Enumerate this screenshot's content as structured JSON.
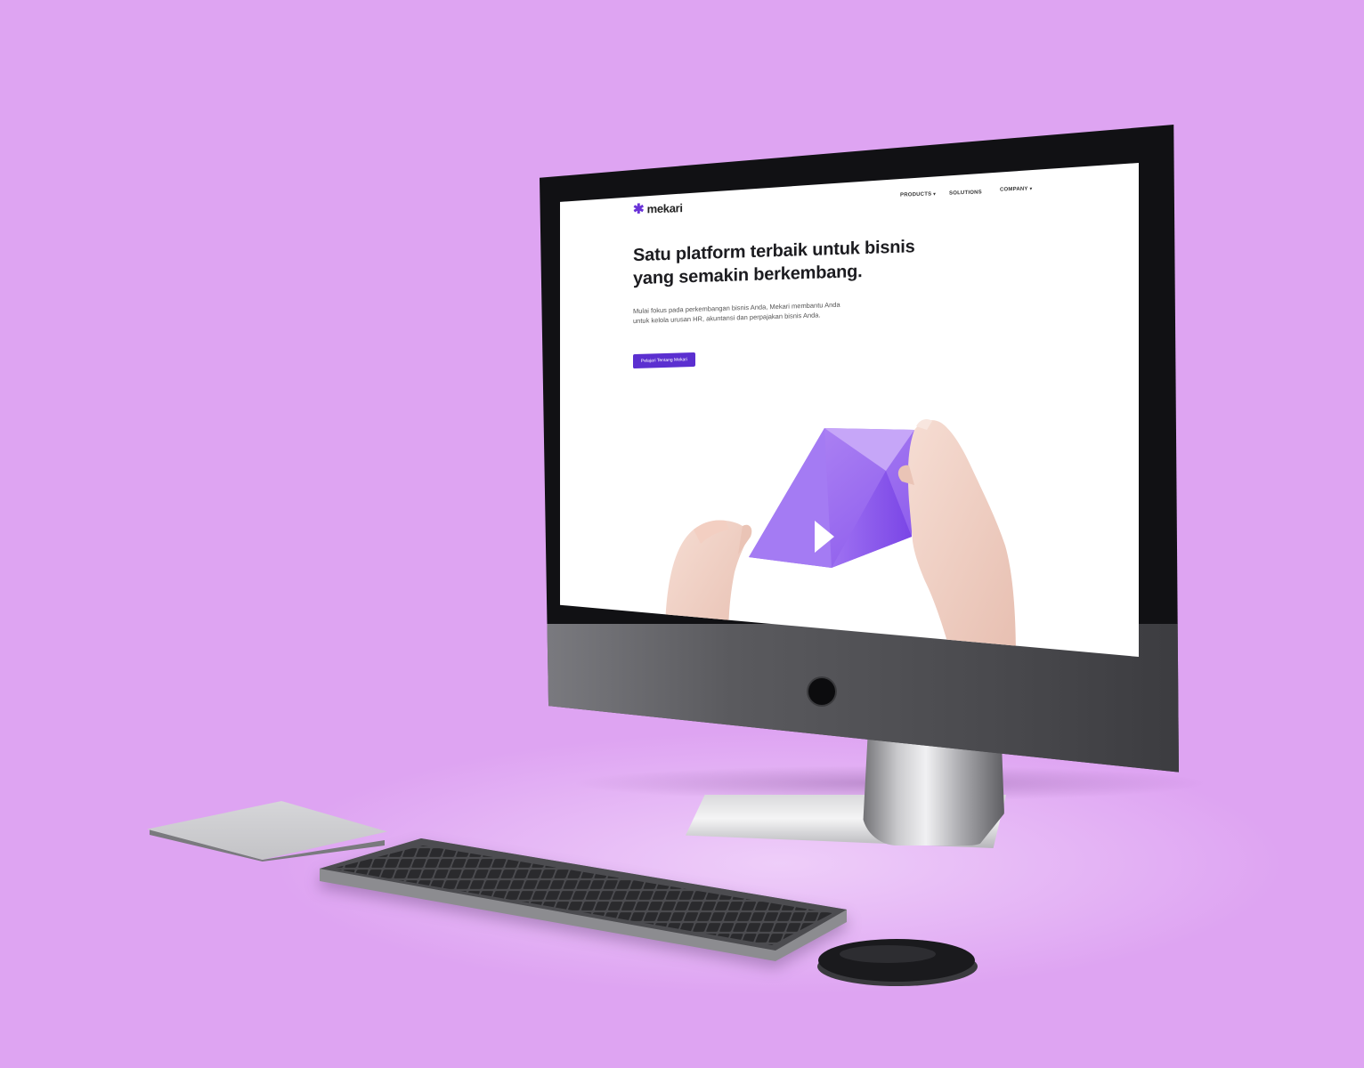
{
  "brand": {
    "name": "mekari",
    "accent_color": "#5b2fd0",
    "logo_icon": "asterisk-logo-icon"
  },
  "nav": {
    "products": "PRODUCTS",
    "solutions": "SOLUTIONS",
    "company": "COMPANY"
  },
  "hero": {
    "headline_line1": "Satu platform terbaik untuk bisnis",
    "headline_line2": "yang semakin berkembang.",
    "intro_line1": "Mulai fokus pada perkembangan bisnis Anda, Mekari membantu Anda",
    "intro_line2": "untuk kelola urusan HR, akuntansi dan perpajakan bisnis Anda.",
    "cta_label": "Pelajari Tentang Mekari",
    "video_icon": "play-icon"
  },
  "colors": {
    "background": "#dea4f2",
    "paper": "#9b6df0"
  }
}
